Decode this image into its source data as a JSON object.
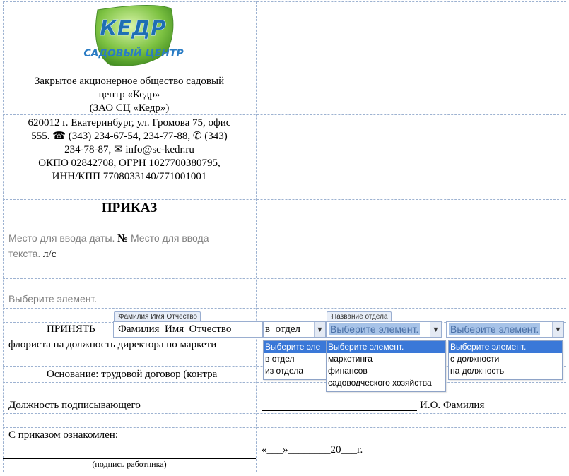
{
  "logo": {
    "line1": "КЕДР",
    "line2": "САДОВЫЙ ЦЕНТР",
    "accent": "#7dc242",
    "text_color": "#1e6fb3"
  },
  "header": {
    "company_lines": [
      "Закрытое акционерное общество садовый",
      "центр «Кедр»",
      "(ЗАО СЦ «Кедр»)"
    ],
    "address_lines": [
      "620012 г. Екатеринбург, ул. Громова 75, офис",
      "555. ☎ (343) 234-67-54, 234-77-88, ✆ (343)",
      "234-78-87, ✉ info@sc-kedr.ru",
      "ОКПО 02842708, ОГРН 1027700380795,",
      "ИНН/КПП 7708033140/771001001"
    ]
  },
  "order": {
    "title": "ПРИКАЗ",
    "date_placeholder": "Место для ввода даты.",
    "number_sign": "№",
    "number_placeholder_1": "Место для ввода",
    "number_placeholder_2": "текста.",
    "suffix": "л/с",
    "element_placeholder": "Выберите элемент."
  },
  "hire": {
    "verb": "ПРИНЯТЬ",
    "name_tag": "Фамилия Имя Отчество",
    "name_value": "Фамилия  Имя  Отчество",
    "dir_value": "в  отдел",
    "dept_tag": "Название отдела",
    "dept_value": "Выберите элемент.",
    "pos_value": "Выберите элемент.",
    "line2": "флориста на должность директора по маркети",
    "basis": "Основание: трудовой договор (контра",
    "dir_options": [
      "Выберите эле",
      "в отдел",
      "из отдела"
    ],
    "dept_options": [
      "Выберите элемент.",
      "маркетинга",
      "финансов",
      "садоводческого хозяйства"
    ],
    "pos_options": [
      "Выберите элемент.",
      "с должности",
      "на должность"
    ]
  },
  "signature": {
    "signer_label": "Должность подписывающего",
    "signer_name": "И.О. Фамилия",
    "ack_label": "С приказом ознакомлен:",
    "date_line": "«___»________20___г.",
    "employee_caption": "(подпись работника)"
  }
}
